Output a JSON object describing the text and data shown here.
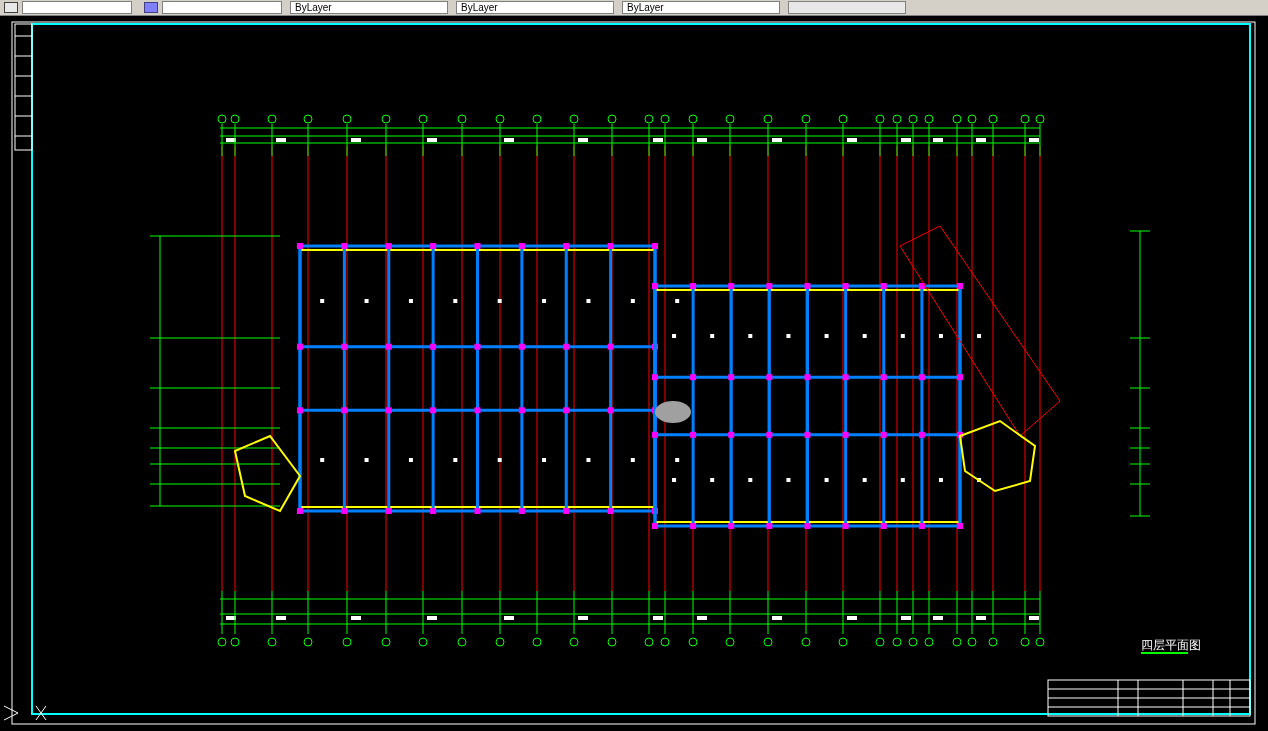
{
  "toolbar": {
    "layer_combos": [
      {
        "value": "ByLayer"
      },
      {
        "value": "ByLayer"
      },
      {
        "value": "ByLayer"
      }
    ]
  },
  "drawing": {
    "title": "四层平面图"
  }
}
